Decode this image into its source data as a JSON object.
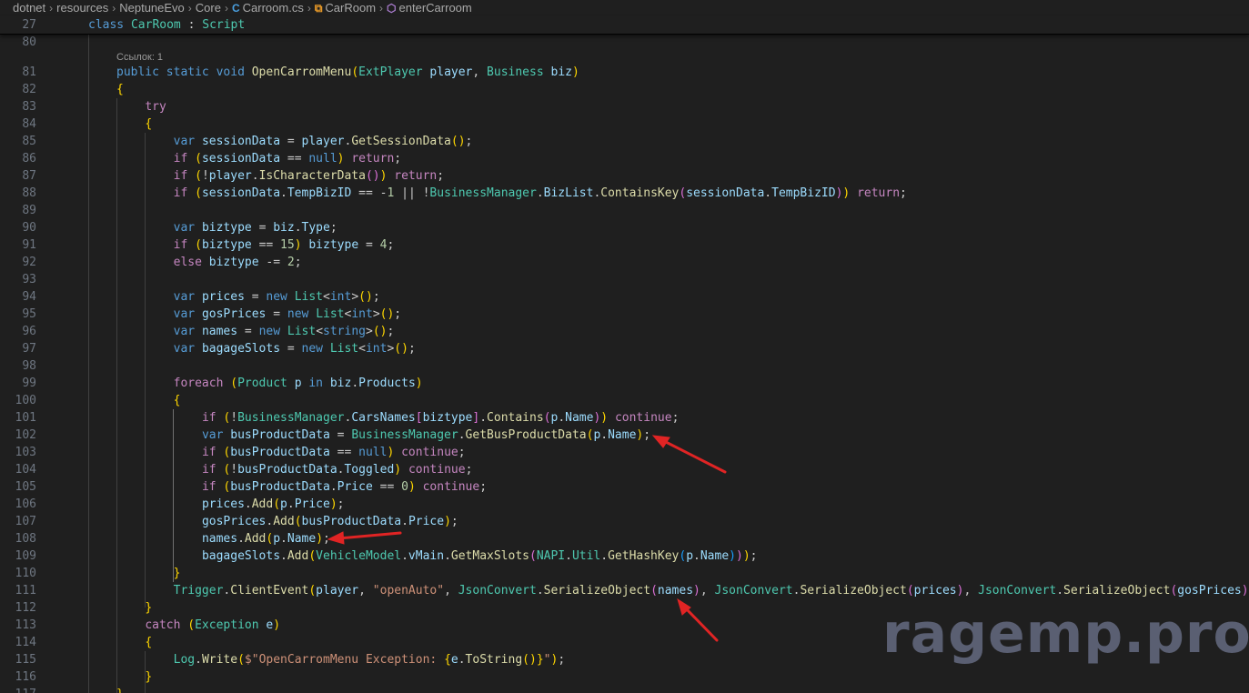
{
  "breadcrumb": {
    "items": [
      "dotnet",
      "resources",
      "NeptuneEvo",
      "Core",
      "Carroom.cs",
      "CarRoom",
      "enterCarroom"
    ]
  },
  "icons": {
    "file": "csharp-file-icon",
    "class": "class-icon",
    "method": "method-icon",
    "separator": "chevron-right-icon"
  },
  "sticky": {
    "line_number": "27",
    "code": "class CarRoom : Script"
  },
  "codelens": "Ссылок: 1",
  "editor": {
    "lines": [
      {
        "n": "80",
        "code": ""
      },
      {
        "n": "81",
        "code": "public static void OpenCarromMenu(ExtPlayer player, Business biz)"
      },
      {
        "n": "82",
        "code": "{"
      },
      {
        "n": "83",
        "code": "    try"
      },
      {
        "n": "84",
        "code": "    {"
      },
      {
        "n": "85",
        "code": "        var sessionData = player.GetSessionData();"
      },
      {
        "n": "86",
        "code": "        if (sessionData == null) return;"
      },
      {
        "n": "87",
        "code": "        if (!player.IsCharacterData()) return;"
      },
      {
        "n": "88",
        "code": "        if (sessionData.TempBizID == -1 || !BusinessManager.BizList.ContainsKey(sessionData.TempBizID)) return;"
      },
      {
        "n": "89",
        "code": ""
      },
      {
        "n": "90",
        "code": "        var biztype = biz.Type;"
      },
      {
        "n": "91",
        "code": "        if (biztype == 15) biztype = 4;"
      },
      {
        "n": "92",
        "code": "        else biztype -= 2;"
      },
      {
        "n": "93",
        "code": ""
      },
      {
        "n": "94",
        "code": "        var prices = new List<int>();"
      },
      {
        "n": "95",
        "code": "        var gosPrices = new List<int>();"
      },
      {
        "n": "96",
        "code": "        var names = new List<string>();"
      },
      {
        "n": "97",
        "code": "        var bagageSlots = new List<int>();"
      },
      {
        "n": "98",
        "code": ""
      },
      {
        "n": "99",
        "code": "        foreach (Product p in biz.Products)"
      },
      {
        "n": "100",
        "code": "        {"
      },
      {
        "n": "101",
        "code": "            if (!BusinessManager.CarsNames[biztype].Contains(p.Name)) continue;"
      },
      {
        "n": "102",
        "code": "            var busProductData = BusinessManager.GetBusProductData(p.Name);"
      },
      {
        "n": "103",
        "code": "            if (busProductData == null) continue;"
      },
      {
        "n": "104",
        "code": "            if (!busProductData.Toggled) continue;"
      },
      {
        "n": "105",
        "code": "            if (busProductData.Price == 0) continue;"
      },
      {
        "n": "106",
        "code": "            prices.Add(p.Price);"
      },
      {
        "n": "107",
        "code": "            gosPrices.Add(busProductData.Price);"
      },
      {
        "n": "108",
        "code": "            names.Add(p.Name);"
      },
      {
        "n": "109",
        "code": "            bagageSlots.Add(VehicleModel.vMain.GetMaxSlots(NAPI.Util.GetHashKey(p.Name)));"
      },
      {
        "n": "110",
        "code": "        }"
      },
      {
        "n": "111",
        "code": "        Trigger.ClientEvent(player, \"openAuto\", JsonConvert.SerializeObject(names), JsonConvert.SerializeObject(prices), JsonConvert.SerializeObject(gosPrices), J"
      },
      {
        "n": "112",
        "code": "    }"
      },
      {
        "n": "113",
        "code": "    catch (Exception e)"
      },
      {
        "n": "114",
        "code": "    {"
      },
      {
        "n": "115",
        "code": "        Log.Write($\"OpenCarromMenu Exception: {e.ToString()}\");"
      },
      {
        "n": "116",
        "code": "    }"
      },
      {
        "n": "117",
        "code": "}"
      }
    ]
  },
  "watermark": "ragemp.pro",
  "colors": {
    "background": "#1f1f1f",
    "keyword": "#569cd6",
    "control": "#c586c0",
    "type": "#4ec9b0",
    "function": "#dcdcaa",
    "variable": "#9cdcfe",
    "string": "#ce9178",
    "number": "#b5cea8",
    "arrow": "#e02424"
  }
}
